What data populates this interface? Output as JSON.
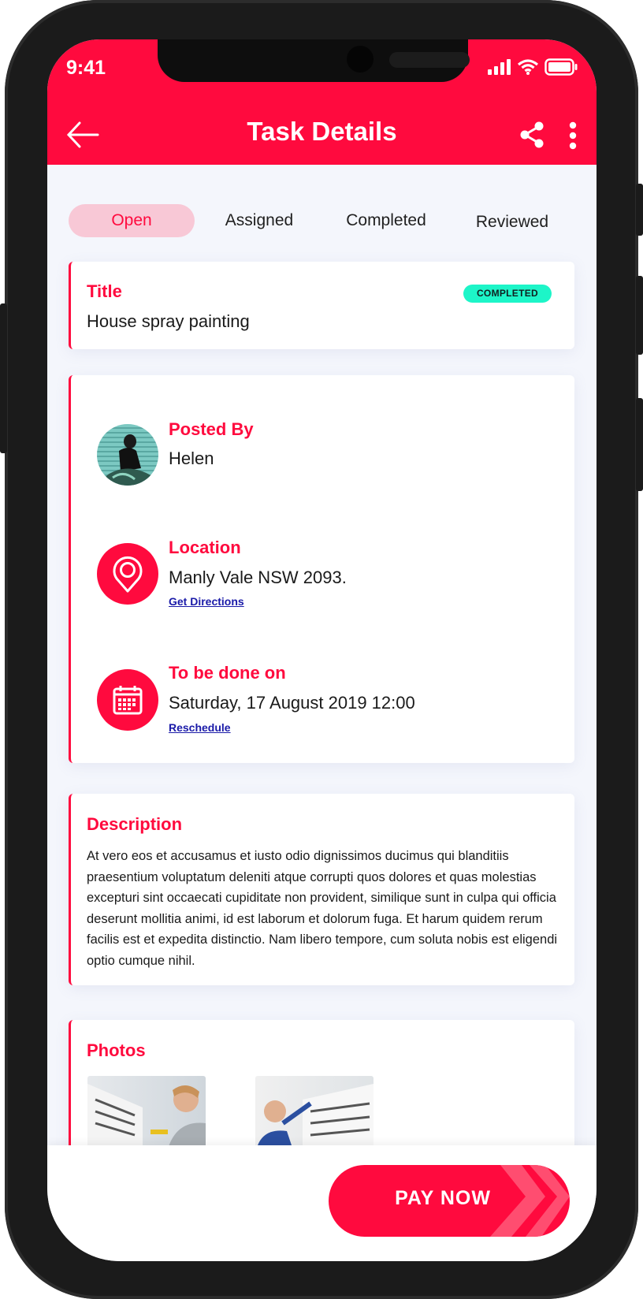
{
  "colors": {
    "accent": "#FF0A3E",
    "badge": "#1DF5C8",
    "link": "#1a1aa8",
    "tab_active_bg": "#F8C8D6",
    "background": "#F4F6FC"
  },
  "status_bar": {
    "time": "9:41",
    "icons": [
      "signal-icon",
      "wifi-icon",
      "battery-icon"
    ]
  },
  "header": {
    "title": "Task Details",
    "icons": [
      "back-arrow-icon",
      "share-icon",
      "more-vertical-icon"
    ]
  },
  "tabs": [
    {
      "label": "Open",
      "active": true
    },
    {
      "label": "Assigned",
      "active": false
    },
    {
      "label": "Completed",
      "active": false
    },
    {
      "label": "Reviewed",
      "active": false
    }
  ],
  "title_card": {
    "label": "Title",
    "value": "House spray painting",
    "status": "COMPLETED"
  },
  "posted_by": {
    "label": "Posted By",
    "value": "Helen"
  },
  "location": {
    "label": "Location",
    "value": "Manly Vale NSW 2093.",
    "link": "Get Directions",
    "icon": "map-pin-icon"
  },
  "schedule": {
    "label": "To be done on",
    "value": "Saturday, 17 August 2019 12:00",
    "link": "Reschedule",
    "icon": "calendar-icon"
  },
  "description": {
    "label": "Description",
    "text": "At vero eos et accusamus et iusto odio dignissimos ducimus qui blanditiis praesentium voluptatum deleniti atque corrupti quos dolores et quas molestias excepturi sint occaecati cupiditate non provident, similique sunt in culpa qui officia deserunt mollitia animi, id est laborum et dolorum fuga. Et harum quidem rerum facilis est et expedita distinctio. Nam libero tempore, cum soluta nobis est eligendi optio cumque nihil."
  },
  "photos": {
    "label": "Photos",
    "count": 2
  },
  "footer": {
    "pay_label": "PAY NOW"
  }
}
